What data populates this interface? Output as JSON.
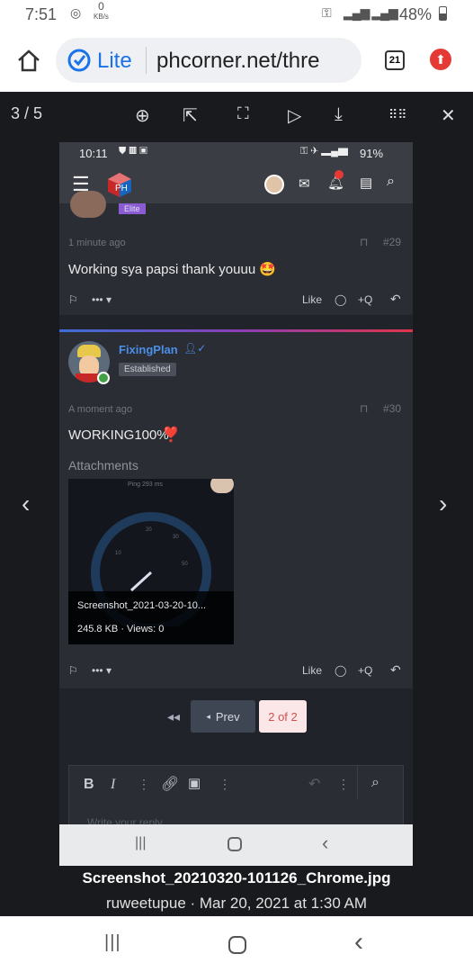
{
  "status": {
    "time": "7:51",
    "kb": "0",
    "kb_unit": "KB/s",
    "battery": "48%",
    "signal": "4G+"
  },
  "browser": {
    "lite_label": "Lite",
    "url": "phcorner.net/thre",
    "tabs": "21"
  },
  "viewer": {
    "counter": "3 / 5",
    "filename": "Screenshot_20210320-101126_Chrome.jpg",
    "meta": "ruweetupue · Mar 20, 2021 at 1:30 AM"
  },
  "inner": {
    "status": {
      "time": "10:11",
      "battery": "91%"
    },
    "prev_badge": "Elite",
    "post1": {
      "time": "1 minute ago",
      "num": "#29",
      "text": "Working sya papsi thank youuu 🤩",
      "like": "Like",
      "quote": "+Q"
    },
    "user": {
      "name": "FixingPlan",
      "badge": "Established"
    },
    "post2": {
      "time": "A moment ago",
      "num": "#30",
      "text": "WORKING100%",
      "heart": "❣️",
      "attachments": "Attachments",
      "attachment": {
        "ping": "Ping 293 ms",
        "name": "Screenshot_2021-03-20-10...",
        "meta": "245.8 KB · Views: 0"
      },
      "like": "Like",
      "quote": "+Q"
    },
    "pager": {
      "prev": "Prev",
      "current": "2 of 2"
    },
    "editor": {
      "placeholder": "Write your reply..."
    }
  },
  "colors": {
    "accent": "#1a73e8",
    "link": "#4a8fe7",
    "badge": "#8a5cd1"
  }
}
